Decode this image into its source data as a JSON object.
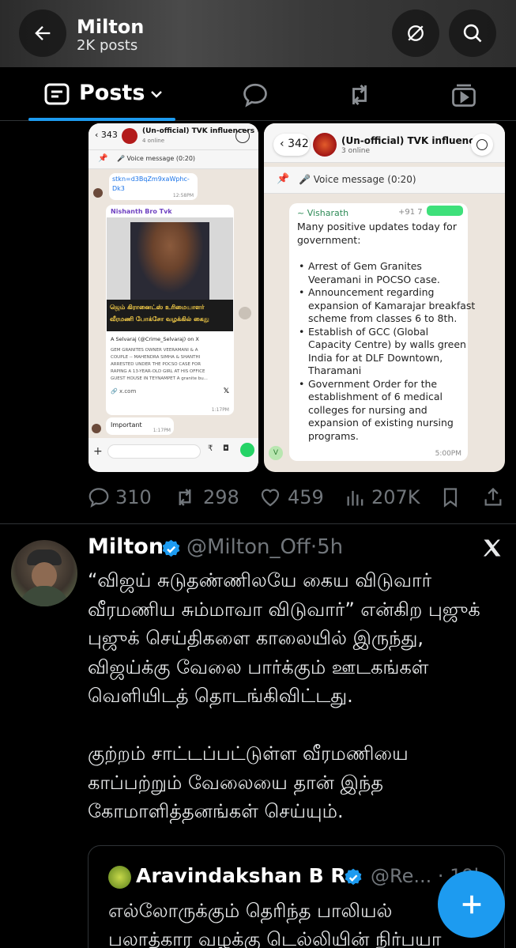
{
  "header": {
    "title": "Milton",
    "subtitle": "2K posts",
    "back_icon": "arrow-left-icon",
    "notif_off_icon": "no-notifications-icon",
    "search_icon": "search-icon"
  },
  "tabs": {
    "active_label": "Posts",
    "items": [
      "posts",
      "replies",
      "reposts",
      "media"
    ]
  },
  "media_left": {
    "back_count": "343",
    "group_name": "(Un-official) TVK influencers",
    "online": "4 online",
    "pinned": "Voice message (0:20)",
    "link_text": "stkn=d3BqZm9xaWphc-",
    "link_text2": "Dk3",
    "link_time": "12:58PM",
    "sender": "Nishanth Bro Tvk",
    "news_caption_1": "ஜெம் கிரானைட்ஸ் உரிமையாளர்",
    "news_caption_2": "வீரமணி போக்சோ வழக்கில் கைது",
    "tweet_author": "A Selvaraj (@Crime_Selvaraj) on X",
    "tweet_body_1": "GEM GRANITES OWNER VEERAMANI & A",
    "tweet_body_2": "COUPLE -- MAHENDRA SIMHA & SHANTHI",
    "tweet_body_3": "ARRESTED UNDER THE POCSO CASE FOR",
    "tweet_body_4": "RAPING A 13-YEAR-OLD GIRL AT HIS OFFICE",
    "tweet_body_5": "GUEST HOUSE IN TEYNAMPET A granite bu...",
    "domain": "x.com",
    "msg_time": "1:17PM",
    "important": "Important",
    "important_time": "1:17PM"
  },
  "media_right": {
    "back_count": "342",
    "group_name": "(Un-official) TVK influencers",
    "online": "3 online",
    "pinned": "Voice message (0:20)",
    "sender": "~ Visharath",
    "phone_prefix": "+91 7",
    "intro_1": "Many positive updates today for",
    "intro_2": "government:",
    "bullets": [
      [
        "Arrest of Gem Granites",
        "Veeramani in POCSO case."
      ],
      [
        "Announcement regarding",
        "expansion of Kamarajar breakfast",
        "scheme from classes 6 to 8th."
      ],
      [
        "Establish of GCC (Global",
        "Capacity Centre) by walls green",
        "India for at DLF Downtown,",
        "Tharamani"
      ],
      [
        "Government Order for the",
        "establishment of 6 medical",
        "colleges for nursing and",
        "expansion of existing nursing",
        "programs."
      ]
    ],
    "time": "5:00PM",
    "avatar_letter": "V"
  },
  "stats": {
    "replies": "310",
    "reposts": "298",
    "likes": "459",
    "views": "207K"
  },
  "post": {
    "name": "Milton",
    "handle": "@Milton_Off·5h",
    "lines": [
      "“விஜய் சுடுதண்ணிலயே கைய விடுவார்",
      "வீரமணிய சும்மாவா விடுவார்” என்கிற புஜுக்",
      "புஜுக் செய்திகளை காலையில் இருந்து,",
      "விஜய்க்கு வேலை பார்க்கும் ஊடகங்கள்",
      "வெளியிடத் தொடங்கிவிட்டது."
    ],
    "lines2": [
      "குற்றம் சாட்டப்பட்டுள்ள வீரமணியை",
      "காப்பற்றும் வேலையை தான் இந்த",
      "கோமாளித்தனங்கள் செய்யும்."
    ]
  },
  "quote": {
    "name": "Aravindakshan B R",
    "handle": "@Re... · 19h",
    "line1": "எல்லோருக்கும் தெரிந்த பாலியல்",
    "line2": "பலாத்கார வழக்கு டெல்லியின் நிர்பயா"
  },
  "colors": {
    "accent": "#1d9bf0",
    "muted": "#71767b",
    "whatsapp_green": "#25d366"
  }
}
